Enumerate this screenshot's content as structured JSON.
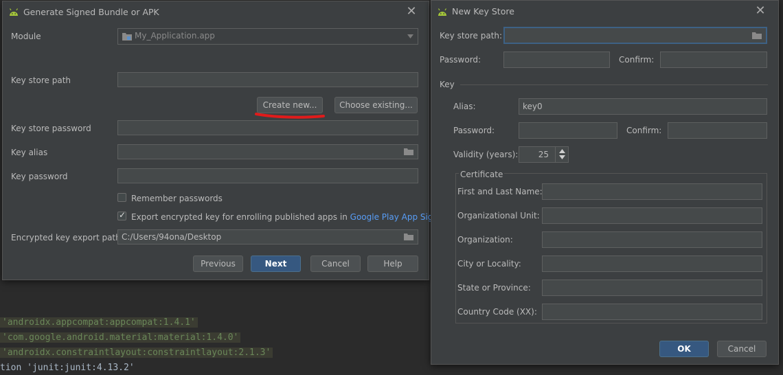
{
  "editor": {
    "lines": [
      {
        "text": "'androidx.appcompat:appcompat:1.4.1'",
        "kind": "string"
      },
      {
        "text": "'com.google.android.material:material:1.4.0'",
        "kind": "string"
      },
      {
        "text": "'androidx.constraintlayout:constraintlayout:2.1.3'",
        "kind": "string"
      },
      {
        "text": "tion 'junit:junit:4.13.2'",
        "kind": "plain"
      }
    ]
  },
  "bundle_dialog": {
    "title": "Generate Signed Bundle or APK",
    "module_label": "Module",
    "module_value": "My_Application.app",
    "keystore_path_label": "Key store path",
    "create_new_label": "Create new...",
    "choose_existing_label": "Choose existing...",
    "keystore_password_label": "Key store password",
    "key_alias_label": "Key alias",
    "key_password_label": "Key password",
    "remember_passwords_label": "Remember passwords",
    "remember_passwords_checked": false,
    "export_encrypted_label": "Export encrypted key for enrolling published apps in",
    "export_encrypted_link": "Google Play App Signing",
    "export_encrypted_checked": true,
    "encrypted_export_path_label": "Encrypted key export path",
    "encrypted_export_path_value": "C:/Users/94ona/Desktop",
    "previous_label": "Previous",
    "next_label": "Next",
    "cancel_label": "Cancel",
    "help_label": "Help"
  },
  "keystore_dialog": {
    "title": "New Key Store",
    "keystore_path_label": "Key store path:",
    "keystore_path_value": "",
    "password_label": "Password:",
    "confirm_label": "Confirm:",
    "key_section_label": "Key",
    "alias_label": "Alias:",
    "alias_value": "key0",
    "key_password_label": "Password:",
    "key_confirm_label": "Confirm:",
    "validity_label": "Validity (years):",
    "validity_value": "25",
    "certificate_label": "Certificate",
    "first_last_label": "First and Last Name:",
    "org_unit_label": "Organizational Unit:",
    "organization_label": "Organization:",
    "city_label": "City or Locality:",
    "state_label": "State or Province:",
    "country_label": "Country Code (XX):",
    "ok_label": "OK",
    "cancel_label": "Cancel"
  },
  "colors": {
    "accent_primary": "#365880",
    "link": "#589df6",
    "annotation_underline": "#e01b1b",
    "android_green": "#a4c639"
  }
}
